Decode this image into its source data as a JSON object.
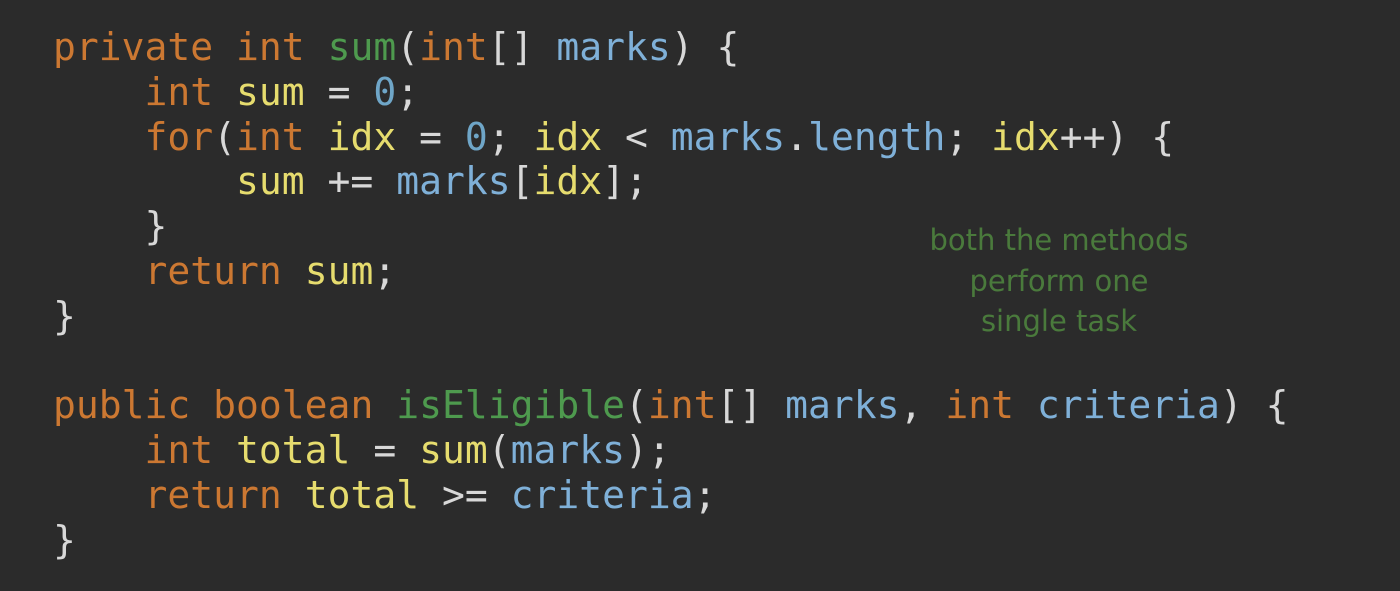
{
  "colors": {
    "background": "#2b2b2b",
    "keyword": "#cc7832",
    "function": "#4e9a4e",
    "parameter": "#7fb0d8",
    "variable": "#e6dc6e",
    "number": "#6fa6c8",
    "punctuation": "#d8d8d8",
    "annotation": "#4a7a3c"
  },
  "code": {
    "lines": [
      [
        {
          "t": "private",
          "k": "kw"
        },
        {
          "t": " ",
          "k": "punc"
        },
        {
          "t": "int",
          "k": "kw"
        },
        {
          "t": " ",
          "k": "punc"
        },
        {
          "t": "sum",
          "k": "fn"
        },
        {
          "t": "(",
          "k": "punc"
        },
        {
          "t": "int",
          "k": "kw"
        },
        {
          "t": "[] ",
          "k": "punc"
        },
        {
          "t": "marks",
          "k": "param"
        },
        {
          "t": ") {",
          "k": "punc"
        }
      ],
      [
        {
          "t": "    ",
          "k": "punc"
        },
        {
          "t": "int",
          "k": "kw"
        },
        {
          "t": " ",
          "k": "punc"
        },
        {
          "t": "sum",
          "k": "var"
        },
        {
          "t": " = ",
          "k": "op"
        },
        {
          "t": "0",
          "k": "num"
        },
        {
          "t": ";",
          "k": "punc"
        }
      ],
      [
        {
          "t": "    ",
          "k": "punc"
        },
        {
          "t": "for",
          "k": "kw"
        },
        {
          "t": "(",
          "k": "punc"
        },
        {
          "t": "int",
          "k": "kw"
        },
        {
          "t": " ",
          "k": "punc"
        },
        {
          "t": "idx",
          "k": "var"
        },
        {
          "t": " = ",
          "k": "op"
        },
        {
          "t": "0",
          "k": "num"
        },
        {
          "t": "; ",
          "k": "punc"
        },
        {
          "t": "idx",
          "k": "var"
        },
        {
          "t": " < ",
          "k": "op"
        },
        {
          "t": "marks",
          "k": "param"
        },
        {
          "t": ".",
          "k": "punc"
        },
        {
          "t": "length",
          "k": "param"
        },
        {
          "t": "; ",
          "k": "punc"
        },
        {
          "t": "idx",
          "k": "var"
        },
        {
          "t": "++) {",
          "k": "punc"
        }
      ],
      [
        {
          "t": "        ",
          "k": "punc"
        },
        {
          "t": "sum",
          "k": "var"
        },
        {
          "t": " += ",
          "k": "op"
        },
        {
          "t": "marks",
          "k": "param"
        },
        {
          "t": "[",
          "k": "punc"
        },
        {
          "t": "idx",
          "k": "var"
        },
        {
          "t": "];",
          "k": "punc"
        }
      ],
      [
        {
          "t": "    ",
          "k": "punc"
        },
        {
          "t": "}",
          "k": "punc"
        }
      ],
      [
        {
          "t": "    ",
          "k": "punc"
        },
        {
          "t": "return",
          "k": "kw"
        },
        {
          "t": " ",
          "k": "punc"
        },
        {
          "t": "sum",
          "k": "var"
        },
        {
          "t": ";",
          "k": "punc"
        }
      ],
      [
        {
          "t": "}",
          "k": "punc"
        }
      ],
      [],
      [
        {
          "t": "public",
          "k": "kw"
        },
        {
          "t": " ",
          "k": "punc"
        },
        {
          "t": "boolean",
          "k": "kw"
        },
        {
          "t": " ",
          "k": "punc"
        },
        {
          "t": "isEligible",
          "k": "fn"
        },
        {
          "t": "(",
          "k": "punc"
        },
        {
          "t": "int",
          "k": "kw"
        },
        {
          "t": "[] ",
          "k": "punc"
        },
        {
          "t": "marks",
          "k": "param"
        },
        {
          "t": ", ",
          "k": "punc"
        },
        {
          "t": "int",
          "k": "kw"
        },
        {
          "t": " ",
          "k": "punc"
        },
        {
          "t": "criteria",
          "k": "param"
        },
        {
          "t": ") {",
          "k": "punc"
        }
      ],
      [
        {
          "t": "    ",
          "k": "punc"
        },
        {
          "t": "int",
          "k": "kw"
        },
        {
          "t": " ",
          "k": "punc"
        },
        {
          "t": "total",
          "k": "var"
        },
        {
          "t": " = ",
          "k": "op"
        },
        {
          "t": "sum",
          "k": "var"
        },
        {
          "t": "(",
          "k": "punc"
        },
        {
          "t": "marks",
          "k": "param"
        },
        {
          "t": ");",
          "k": "punc"
        }
      ],
      [
        {
          "t": "    ",
          "k": "punc"
        },
        {
          "t": "return",
          "k": "kw"
        },
        {
          "t": " ",
          "k": "punc"
        },
        {
          "t": "total",
          "k": "var"
        },
        {
          "t": " >= ",
          "k": "op"
        },
        {
          "t": "criteria",
          "k": "param"
        },
        {
          "t": ";",
          "k": "punc"
        }
      ],
      [
        {
          "t": "}",
          "k": "punc"
        }
      ]
    ]
  },
  "annotation": {
    "lines": [
      "both the methods",
      "perform one",
      "single task"
    ]
  }
}
